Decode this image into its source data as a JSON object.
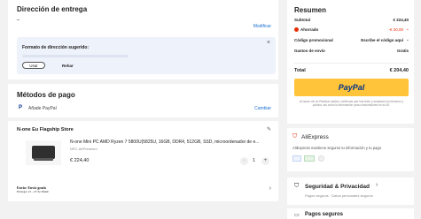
{
  "address": {
    "title": "Dirección de entrega",
    "modify_label": "Modificar",
    "suggest_title": "Formato de dirección sugerido:",
    "use_label": "Usar",
    "dismiss_label": "Rehar"
  },
  "payment_methods": {
    "title": "Métodos de pago",
    "option": "Añade PayPal",
    "change_label": "Cambiar"
  },
  "store": {
    "name": "N-one Eu Flagship Store",
    "product_title": "N-one Mini PC AMD Ryzen 7 5800U(5825U, 16GB, DDR4, 512GB, SSD, microordenador de e...",
    "product_variant": "NPC-AirPremium",
    "price": "€ 224,40",
    "quantity": "1",
    "shipping_line1": "Envío: Envío gratis",
    "shipping_line2": "Entrega: 21 - 27 de MAR"
  },
  "summary": {
    "title": "Resumen",
    "subtotal_label": "Subtotal",
    "subtotal_value": "€ 224,40",
    "saved_label": "Ahorrado",
    "saved_value": "-€ 20,00",
    "promo_label": "Código promocional",
    "promo_value": "Escribe el código aquí",
    "shipping_label": "Gastos de envío",
    "shipping_value": "Gratis",
    "total_label": "Total",
    "total_value": "€ 204,40",
    "paypal_brand": "PayPal",
    "terms_text": "Al hacer clic en Realizar pedido, confirmas que has leído y aceptado los términos y política. así como la información para consumidores en la UE.",
    "accent": "#ffc439"
  },
  "aliexpress": {
    "name": "AliExpress",
    "tagline": "AliExpress mantiene seguros tu información y tu pago"
  },
  "security": {
    "title": "Seguridad & Privacidad",
    "subtitle": "Pagos seguros · Datos personales seguros"
  },
  "secure_payments": {
    "title": "Pagos seguros"
  }
}
